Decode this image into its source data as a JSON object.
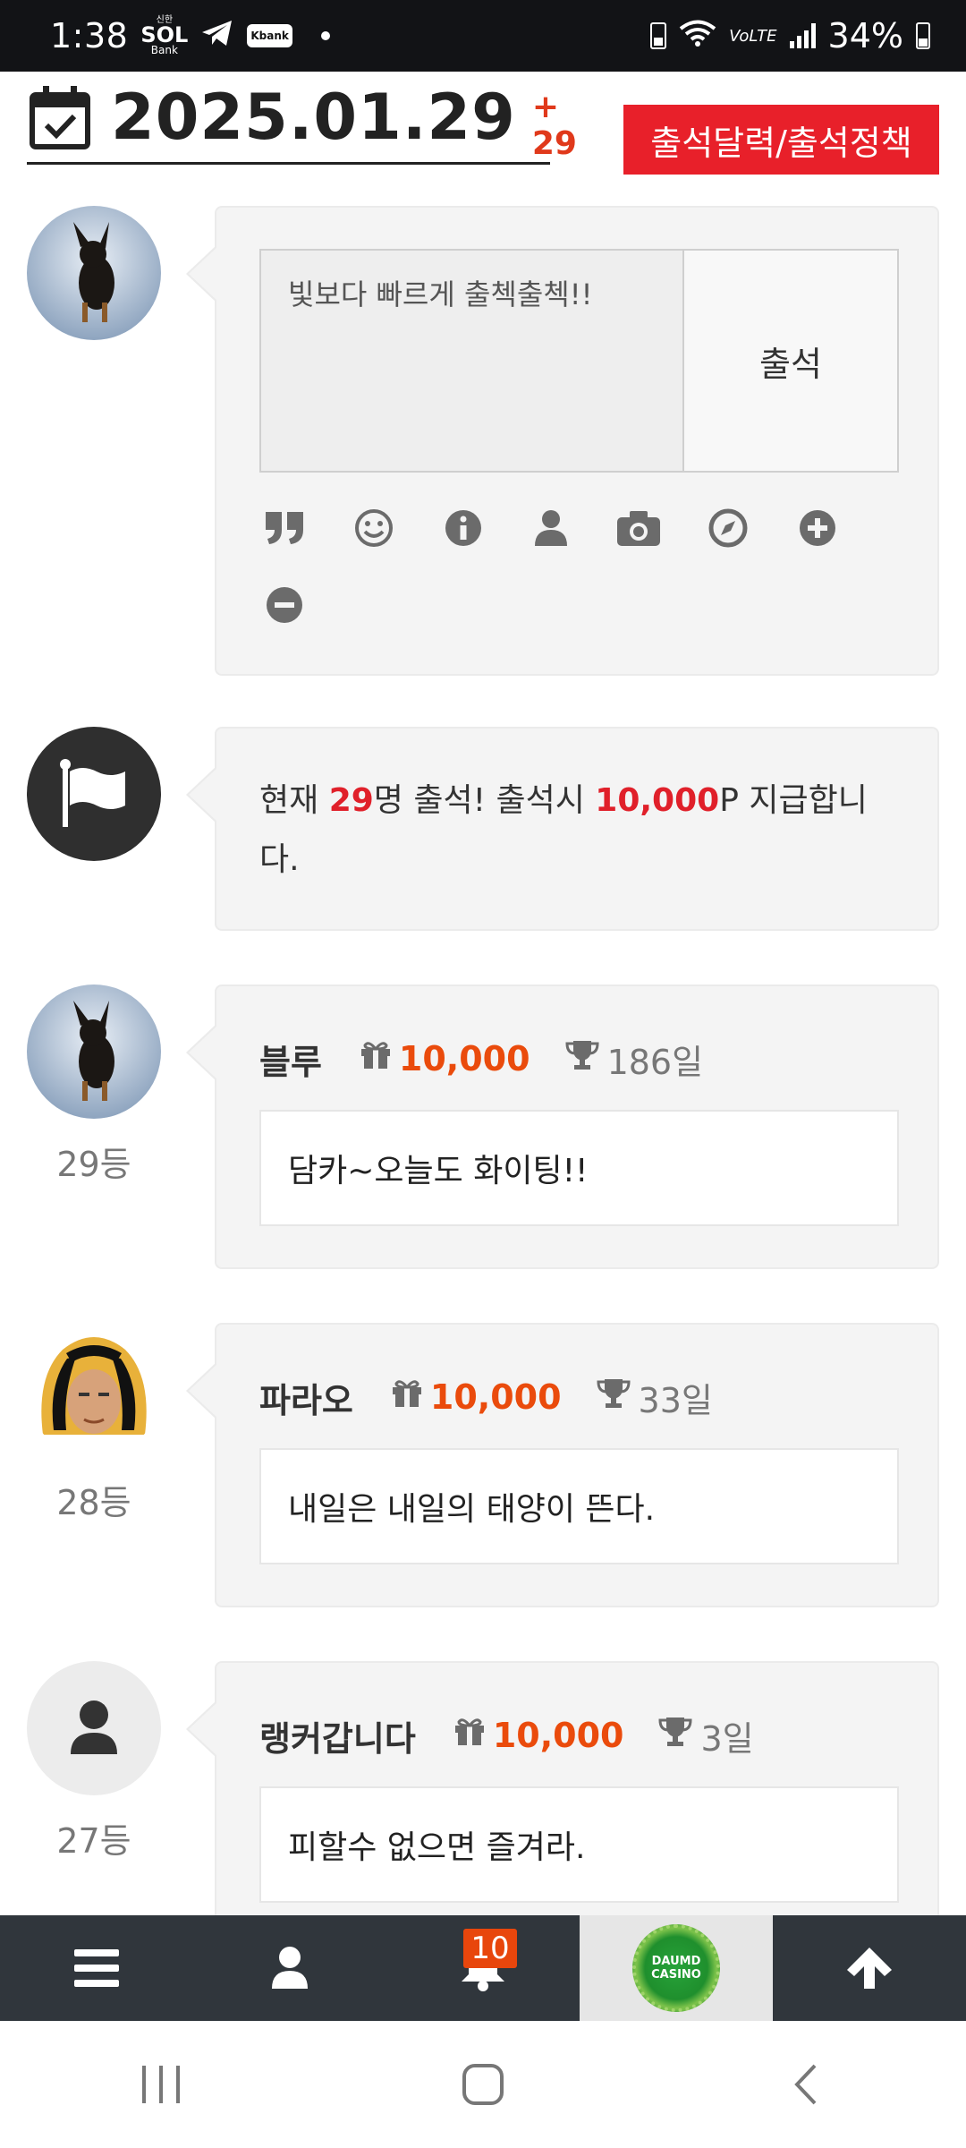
{
  "status_bar": {
    "time": "1:38",
    "app_sol_top": "신한",
    "app_sol": "SOL",
    "app_sol_bottom": "Bank",
    "app_kbank": "Kbank",
    "volte": "VoLTE",
    "battery": "34%"
  },
  "header": {
    "date": "2025.01.29",
    "plus_count": "+ 29",
    "policy_button": "출석달력/출석정책"
  },
  "compose": {
    "message": "빛보다 빠르게 출첵출첵!!",
    "submit_label": "출석",
    "tools": [
      "quote-icon",
      "smile-icon",
      "info-icon",
      "user-icon",
      "camera-icon",
      "compass-icon",
      "plus-circle-icon",
      "minus-circle-icon"
    ]
  },
  "notice": {
    "prefix": "현재 ",
    "count": "29",
    "mid": "명 출석! 출석시 ",
    "points": "10,000",
    "suffix": "P 지급합니다."
  },
  "entries": [
    {
      "nickname": "블루",
      "points": "10,000",
      "days": "186일",
      "rank": "29등",
      "comment": "담카~오늘도 화이팅!!"
    },
    {
      "nickname": "파라오",
      "points": "10,000",
      "days": "33일",
      "rank": "28등",
      "comment": "내일은 내일의 태양이 뜬다."
    },
    {
      "nickname": "랭커갑니다",
      "points": "10,000",
      "days": "3일",
      "rank": "27등",
      "comment": "피할수 없으면 즐겨라."
    }
  ],
  "bottom_nav": {
    "items": [
      "menu-icon",
      "user-icon",
      "bell-icon",
      "casino-logo",
      "arrow-up-icon"
    ],
    "notification_count": "10",
    "logo_line1": "DAUMD",
    "logo_line2": "CASINO"
  },
  "colors": {
    "accent_red": "#e8202a",
    "points_orange": "#ea4b0c",
    "nav_bg": "#30363c"
  }
}
